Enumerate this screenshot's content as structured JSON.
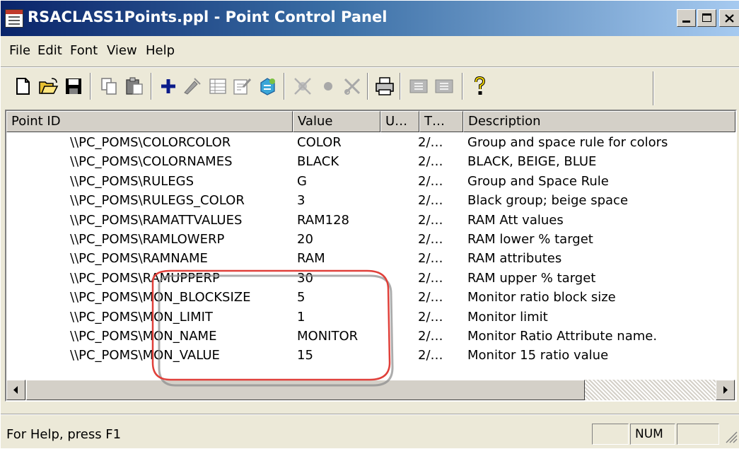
{
  "window": {
    "title": "RSACLASS1Points.ppl - Point Control Panel",
    "caption_buttons": [
      "minimize",
      "maximize",
      "close"
    ]
  },
  "menu": [
    {
      "label": "File"
    },
    {
      "label": "Edit"
    },
    {
      "label": "Font"
    },
    {
      "label": "View"
    },
    {
      "label": "Help"
    }
  ],
  "toolbar": {
    "icons": [
      "new-file-icon",
      "open-folder-icon",
      "save-icon",
      "copy-icon",
      "paste-icon",
      "add-icon",
      "edit-point-icon",
      "table-icon",
      "properties-icon",
      "connect-icon",
      "disconnect-icon",
      "record-icon",
      "cut-icon",
      "print-icon",
      "collapse-icon",
      "expand-icon",
      "help-icon"
    ]
  },
  "list": {
    "columns": [
      "Point ID",
      "Value",
      "U…",
      "T…",
      "Description"
    ],
    "rows": [
      {
        "id": "\\\\PC_POMS\\COLORCOLOR",
        "value": "COLOR",
        "u": "",
        "t": "2/…",
        "desc": "Group and space rule for colors"
      },
      {
        "id": "\\\\PC_POMS\\COLORNAMES",
        "value": "BLACK",
        "u": "",
        "t": "2/…",
        "desc": "BLACK, BEIGE, BLUE"
      },
      {
        "id": "\\\\PC_POMS\\RULEGS",
        "value": "G",
        "u": "",
        "t": "2/…",
        "desc": "Group and Space Rule"
      },
      {
        "id": "\\\\PC_POMS\\RULEGS_COLOR",
        "value": "3",
        "u": "",
        "t": "2/…",
        "desc": "Black group; beige space"
      },
      {
        "id": "\\\\PC_POMS\\RAMATTVALUES",
        "value": "RAM128",
        "u": "",
        "t": "2/…",
        "desc": "RAM Att values"
      },
      {
        "id": "\\\\PC_POMS\\RAMLOWERP",
        "value": "20",
        "u": "",
        "t": "2/…",
        "desc": "RAM lower % target"
      },
      {
        "id": "\\\\PC_POMS\\RAMNAME",
        "value": "RAM",
        "u": "",
        "t": "2/…",
        "desc": "RAM attributes"
      },
      {
        "id": "\\\\PC_POMS\\RAMUPPERP",
        "value": "30",
        "u": "",
        "t": "2/…",
        "desc": "RAM upper % target"
      },
      {
        "id": "\\\\PC_POMS\\MON_BLOCKSIZE",
        "value": "5",
        "u": "",
        "t": "2/…",
        "desc": "Monitor ratio block size"
      },
      {
        "id": "\\\\PC_POMS\\MON_LIMIT",
        "value": "1",
        "u": "",
        "t": "2/…",
        "desc": "Monitor limit"
      },
      {
        "id": "\\\\PC_POMS\\MON_NAME",
        "value": "MONITOR",
        "u": "",
        "t": "2/…",
        "desc": "Monitor Ratio Attribute name."
      },
      {
        "id": "\\\\PC_POMS\\MON_VALUE",
        "value": "15",
        "u": "",
        "t": "2/…",
        "desc": "Monitor 15 ratio value"
      }
    ]
  },
  "status": {
    "text": "For Help, press F1",
    "num": "NUM"
  },
  "colors": {
    "title_start": "#0a246a",
    "title_end": "#a6caf0",
    "annotation": "#e0403a"
  }
}
